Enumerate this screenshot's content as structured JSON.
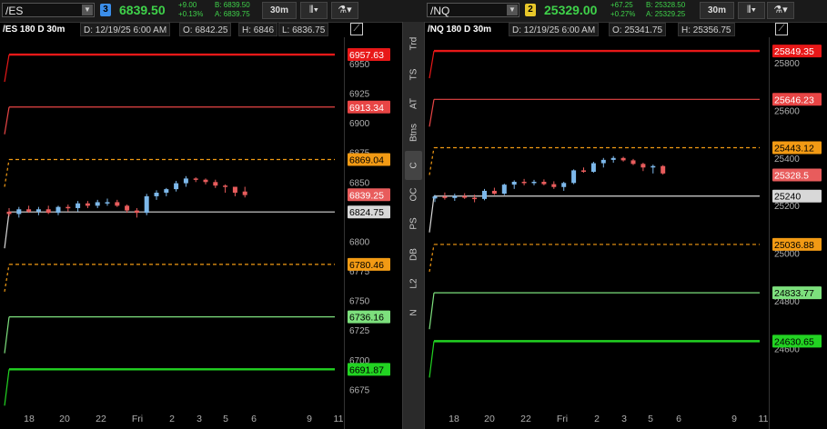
{
  "colors": {
    "up": "#7db8ea",
    "down": "#e85c5c",
    "bright_red": "#e81818",
    "red": "#e84545",
    "orange": "#f29a14",
    "white": "#d8d8d8",
    "light_green": "#7de07d",
    "green": "#22d322"
  },
  "sidebar": {
    "tabs": [
      "Trd",
      "TS",
      "AT",
      "Btns",
      "C",
      "OC",
      "PS",
      "DB",
      "L2",
      "N"
    ],
    "active": "C"
  },
  "left": {
    "symbol": "/ES",
    "link": "3",
    "last": "6839.50",
    "chg": "+9.00",
    "chg_pct": "+0.13%",
    "bid": "B: 6839.50",
    "ask": "A: 6839.75",
    "tf": "30m",
    "header": {
      "title": "/ES 180 D 30m",
      "date": "D: 12/19/25 6:00 AM",
      "open": "O: 6842.25",
      "high": "H: 6846",
      "low": "L: 6836.75"
    },
    "yticks": [
      "6950",
      "6925",
      "6900",
      "6875",
      "6850",
      "6825",
      "6800",
      "6775",
      "6750",
      "6725",
      "6700",
      "6675"
    ],
    "xticks": [
      "18",
      "20",
      "22",
      "Fri",
      "2",
      "3",
      "5",
      "6",
      "9",
      "11"
    ],
    "levels": [
      {
        "label": "6957.63",
        "style": "bright_red"
      },
      {
        "label": "6913.34",
        "style": "red"
      },
      {
        "label": "6869.04",
        "style": "orange"
      },
      {
        "label": "6839.25",
        "style": "down"
      },
      {
        "label": "6824.75",
        "style": "white"
      },
      {
        "label": "6780.46",
        "style": "orange"
      },
      {
        "label": "6736.16",
        "style": "light_green"
      },
      {
        "label": "6691.87",
        "style": "green"
      }
    ],
    "candles": [
      [
        6825,
        6828,
        6821,
        6823
      ],
      [
        6823,
        6829,
        6820,
        6827
      ],
      [
        6827,
        6830,
        6824,
        6825
      ],
      [
        6825,
        6829,
        6822,
        6827
      ],
      [
        6827,
        6830,
        6823,
        6824
      ],
      [
        6824,
        6830,
        6822,
        6829
      ],
      [
        6829,
        6831,
        6825,
        6828
      ],
      [
        6828,
        6834,
        6825,
        6832
      ],
      [
        6832,
        6834,
        6828,
        6830
      ],
      [
        6830,
        6835,
        6828,
        6833
      ],
      [
        6833,
        6836,
        6830,
        6833
      ],
      [
        6833,
        6835,
        6829,
        6830
      ],
      [
        6830,
        6831,
        6824,
        6826
      ],
      [
        6826,
        6828,
        6820,
        6824
      ],
      [
        6824,
        6840,
        6822,
        6838
      ],
      [
        6838,
        6843,
        6835,
        6841
      ],
      [
        6841,
        6845,
        6838,
        6844
      ],
      [
        6844,
        6851,
        6842,
        6849
      ],
      [
        6849,
        6855,
        6846,
        6853
      ],
      [
        6853,
        6854,
        6850,
        6852
      ],
      [
        6852,
        6853,
        6848,
        6850
      ],
      [
        6850,
        6852,
        6845,
        6847
      ],
      [
        6847,
        6848,
        6841,
        6846
      ],
      [
        6846,
        6846,
        6838,
        6841
      ],
      [
        6842,
        6846,
        6837,
        6839
      ]
    ]
  },
  "right": {
    "symbol": "/NQ",
    "link": "2",
    "last": "25329.00",
    "chg": "+67.25",
    "chg_pct": "+0.27%",
    "bid": "B: 25328.50",
    "ask": "A: 25329.25",
    "tf": "30m",
    "header": {
      "title": "/NQ 180 D 30m",
      "date": "D: 12/19/25 6:00 AM",
      "open": "O: 25341.75",
      "high": "H: 25356.75"
    },
    "yticks": [
      "25800",
      "25600",
      "25400",
      "25200",
      "25000",
      "24800",
      "24600"
    ],
    "xticks": [
      "18",
      "20",
      "22",
      "Fri",
      "2",
      "3",
      "5",
      "6",
      "9",
      "11"
    ],
    "levels": [
      {
        "label": "25849.35",
        "style": "bright_red"
      },
      {
        "label": "25646.23",
        "style": "red"
      },
      {
        "label": "25443.12",
        "style": "orange"
      },
      {
        "label": "25328.5",
        "style": "down"
      },
      {
        "label": "25240",
        "style": "white"
      },
      {
        "label": "25036.88",
        "style": "orange"
      },
      {
        "label": "24833.77",
        "style": "light_green"
      },
      {
        "label": "24630.65",
        "style": "green"
      }
    ],
    "candles": [
      [
        25230,
        25245,
        25215,
        25238
      ],
      [
        25238,
        25255,
        25225,
        25232
      ],
      [
        25232,
        25250,
        25220,
        25240
      ],
      [
        25240,
        25252,
        25228,
        25233
      ],
      [
        25233,
        25246,
        25214,
        25228
      ],
      [
        25228,
        25270,
        25222,
        25262
      ],
      [
        25262,
        25275,
        25245,
        25250
      ],
      [
        25250,
        25292,
        25244,
        25288
      ],
      [
        25288,
        25306,
        25270,
        25300
      ],
      [
        25300,
        25312,
        25285,
        25295
      ],
      [
        25295,
        25308,
        25285,
        25300
      ],
      [
        25300,
        25310,
        25285,
        25290
      ],
      [
        25290,
        25302,
        25270,
        25278
      ],
      [
        25278,
        25300,
        25262,
        25295
      ],
      [
        25295,
        25352,
        25290,
        25348
      ],
      [
        25348,
        25360,
        25338,
        25342
      ],
      [
        25342,
        25384,
        25338,
        25378
      ],
      [
        25378,
        25400,
        25360,
        25392
      ],
      [
        25392,
        25408,
        25380,
        25400
      ],
      [
        25400,
        25405,
        25385,
        25390
      ],
      [
        25390,
        25396,
        25370,
        25375
      ],
      [
        25375,
        25380,
        25345,
        25360
      ],
      [
        25360,
        25372,
        25335,
        25366
      ],
      [
        25366,
        25370,
        25330,
        25335
      ]
    ]
  }
}
